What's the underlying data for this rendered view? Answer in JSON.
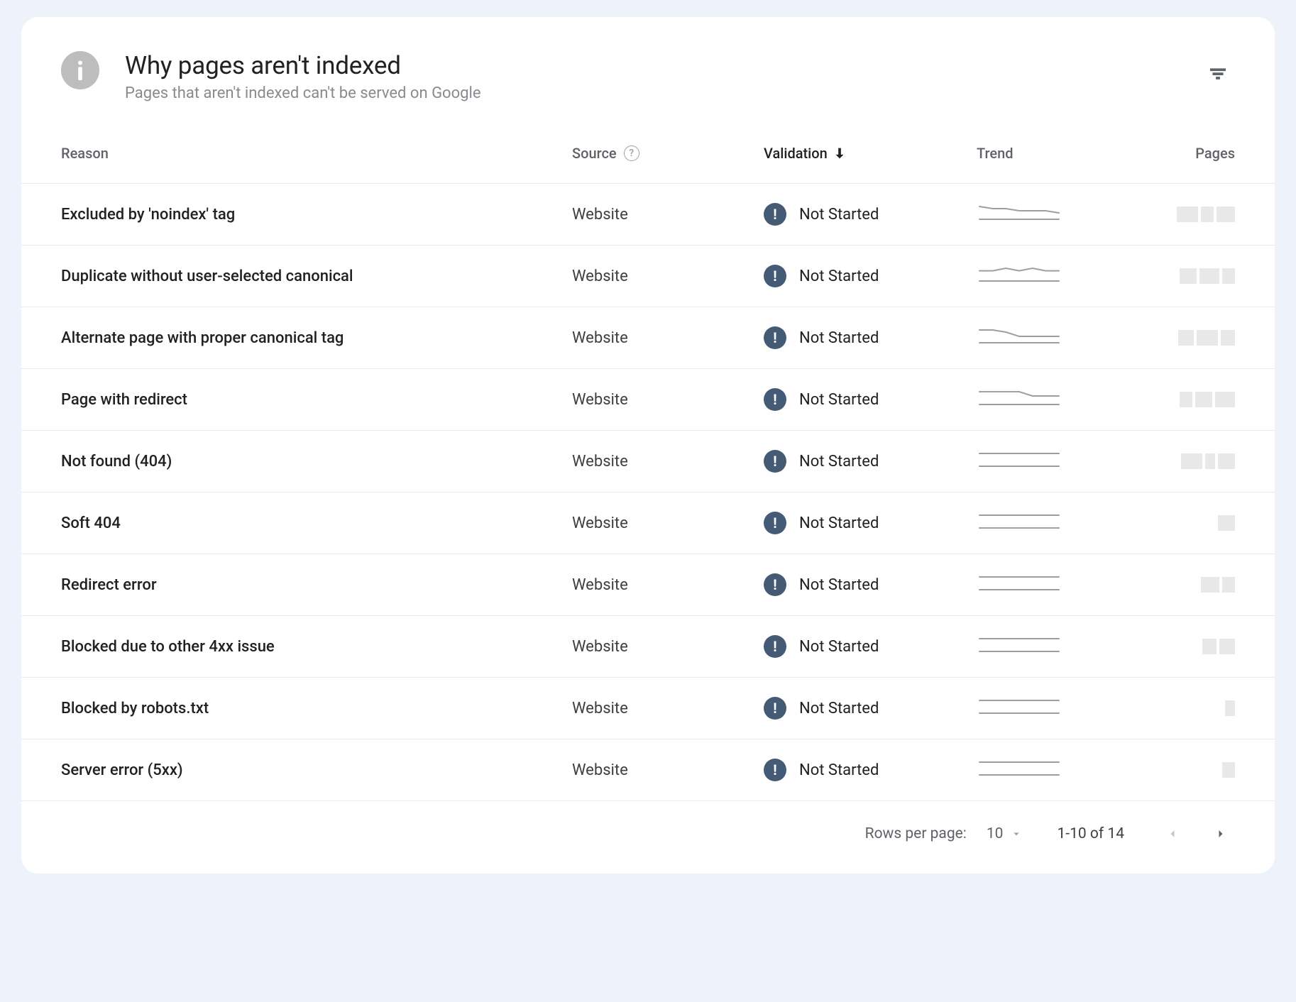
{
  "header": {
    "title": "Why pages aren't indexed",
    "subtitle": "Pages that aren't indexed can't be served on Google"
  },
  "columns": {
    "reason": "Reason",
    "source": "Source",
    "validation": "Validation",
    "trend": "Trend",
    "pages": "Pages"
  },
  "rows": [
    {
      "reason": "Excluded by 'noindex' tag",
      "source": "Website",
      "validation": "Not Started",
      "trend": [
        6,
        5,
        5,
        4,
        4,
        4,
        3
      ],
      "pages_redacted": true
    },
    {
      "reason": "Duplicate without user-selected canonical",
      "source": "Website",
      "validation": "Not Started",
      "trend": [
        4,
        4,
        5,
        4,
        5,
        4,
        4
      ],
      "pages_redacted": true
    },
    {
      "reason": "Alternate page with proper canonical tag",
      "source": "Website",
      "validation": "Not Started",
      "trend": [
        6,
        6,
        5,
        3,
        3,
        3,
        3
      ],
      "pages_redacted": true
    },
    {
      "reason": "Page with redirect",
      "source": "Website",
      "validation": "Not Started",
      "trend": [
        3,
        3,
        3,
        3,
        2,
        2,
        2
      ],
      "pages_redacted": true
    },
    {
      "reason": "Not found (404)",
      "source": "Website",
      "validation": "Not Started",
      "trend": [
        1,
        1,
        1,
        1,
        1,
        1,
        1
      ],
      "pages_redacted": true
    },
    {
      "reason": "Soft 404",
      "source": "Website",
      "validation": "Not Started",
      "trend": [
        1,
        1,
        1,
        1,
        1,
        1,
        1
      ],
      "pages_redacted": true
    },
    {
      "reason": "Redirect error",
      "source": "Website",
      "validation": "Not Started",
      "trend": [
        1,
        1,
        1,
        1,
        1,
        1,
        1
      ],
      "pages_redacted": true
    },
    {
      "reason": "Blocked due to other 4xx issue",
      "source": "Website",
      "validation": "Not Started",
      "trend": [
        1,
        1,
        1,
        1,
        1,
        1,
        1
      ],
      "pages_redacted": true
    },
    {
      "reason": "Blocked by robots.txt",
      "source": "Website",
      "validation": "Not Started",
      "trend": [
        1,
        1,
        1,
        1,
        1,
        1,
        1
      ],
      "pages_redacted": true
    },
    {
      "reason": "Server error (5xx)",
      "source": "Website",
      "validation": "Not Started",
      "trend": [
        1,
        1,
        1,
        1,
        1,
        1,
        1
      ],
      "pages_redacted": true
    }
  ],
  "footer": {
    "rows_per_page_label": "Rows per page:",
    "rows_per_page_value": "10",
    "range": "1-10 of 14"
  }
}
